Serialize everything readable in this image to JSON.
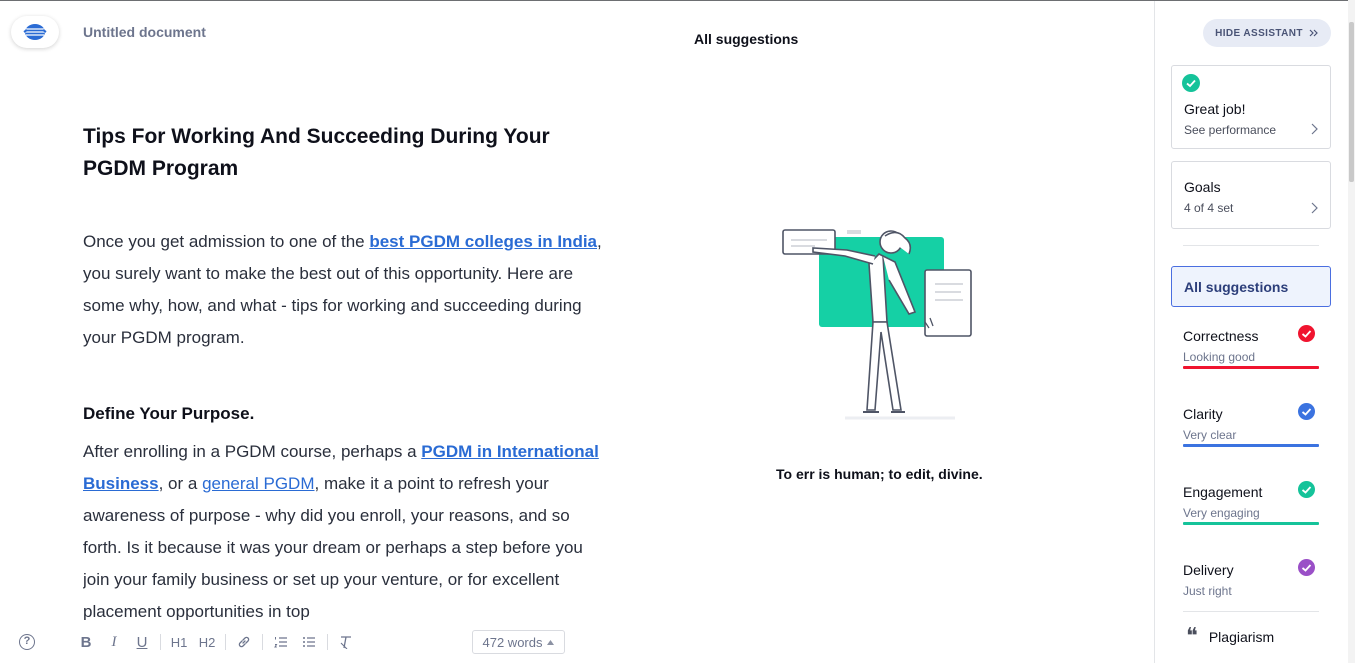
{
  "header": {
    "doc_title": "Untitled document",
    "center_heading": "All suggestions"
  },
  "document": {
    "title": "Tips For Working And Succeeding During Your PGDM Program",
    "para1": {
      "before": "Once you get admission to one of the ",
      "link": "best PGDM colleges in India",
      "after": ", you surely want to make the best out of this opportunity. Here are some why, how, and what - tips for working and succeeding during your PGDM program."
    },
    "heading2": "Define Your Purpose.",
    "para2": {
      "before": "After enrolling in a PGDM course, perhaps a ",
      "link1": "PGDM in International Business",
      "middle": ", or a ",
      "link2": "general PGDM",
      "after": ", make it a point to refresh your awareness of purpose - why did you enroll, your reasons, and so forth. Is it because it was your dream or perhaps a step before you join your family business or set up your venture, or for excellent placement opportunities in top"
    }
  },
  "toolbar": {
    "help": "?",
    "bold": "B",
    "italic": "I",
    "underline": "U",
    "h1": "H1",
    "h2": "H2",
    "word_count": "472 words"
  },
  "illustration": {
    "caption": "To err is human; to edit, divine."
  },
  "assistant": {
    "hide_label": "HIDE ASSISTANT",
    "performance": {
      "title": "Great job!",
      "link": "See performance"
    },
    "goals": {
      "title": "Goals",
      "value": "4 of 4 set"
    },
    "all_suggestions": "All suggestions",
    "categories": [
      {
        "name": "Correctness",
        "status": "Looking good",
        "color": "#f0142f"
      },
      {
        "name": "Clarity",
        "status": "Very clear",
        "color": "#3b73e0"
      },
      {
        "name": "Engagement",
        "status": "Very engaging",
        "color": "#15c39a"
      },
      {
        "name": "Delivery",
        "status": "Just right",
        "color": "#9a4fc7"
      }
    ],
    "plagiarism": "Plagiarism"
  }
}
